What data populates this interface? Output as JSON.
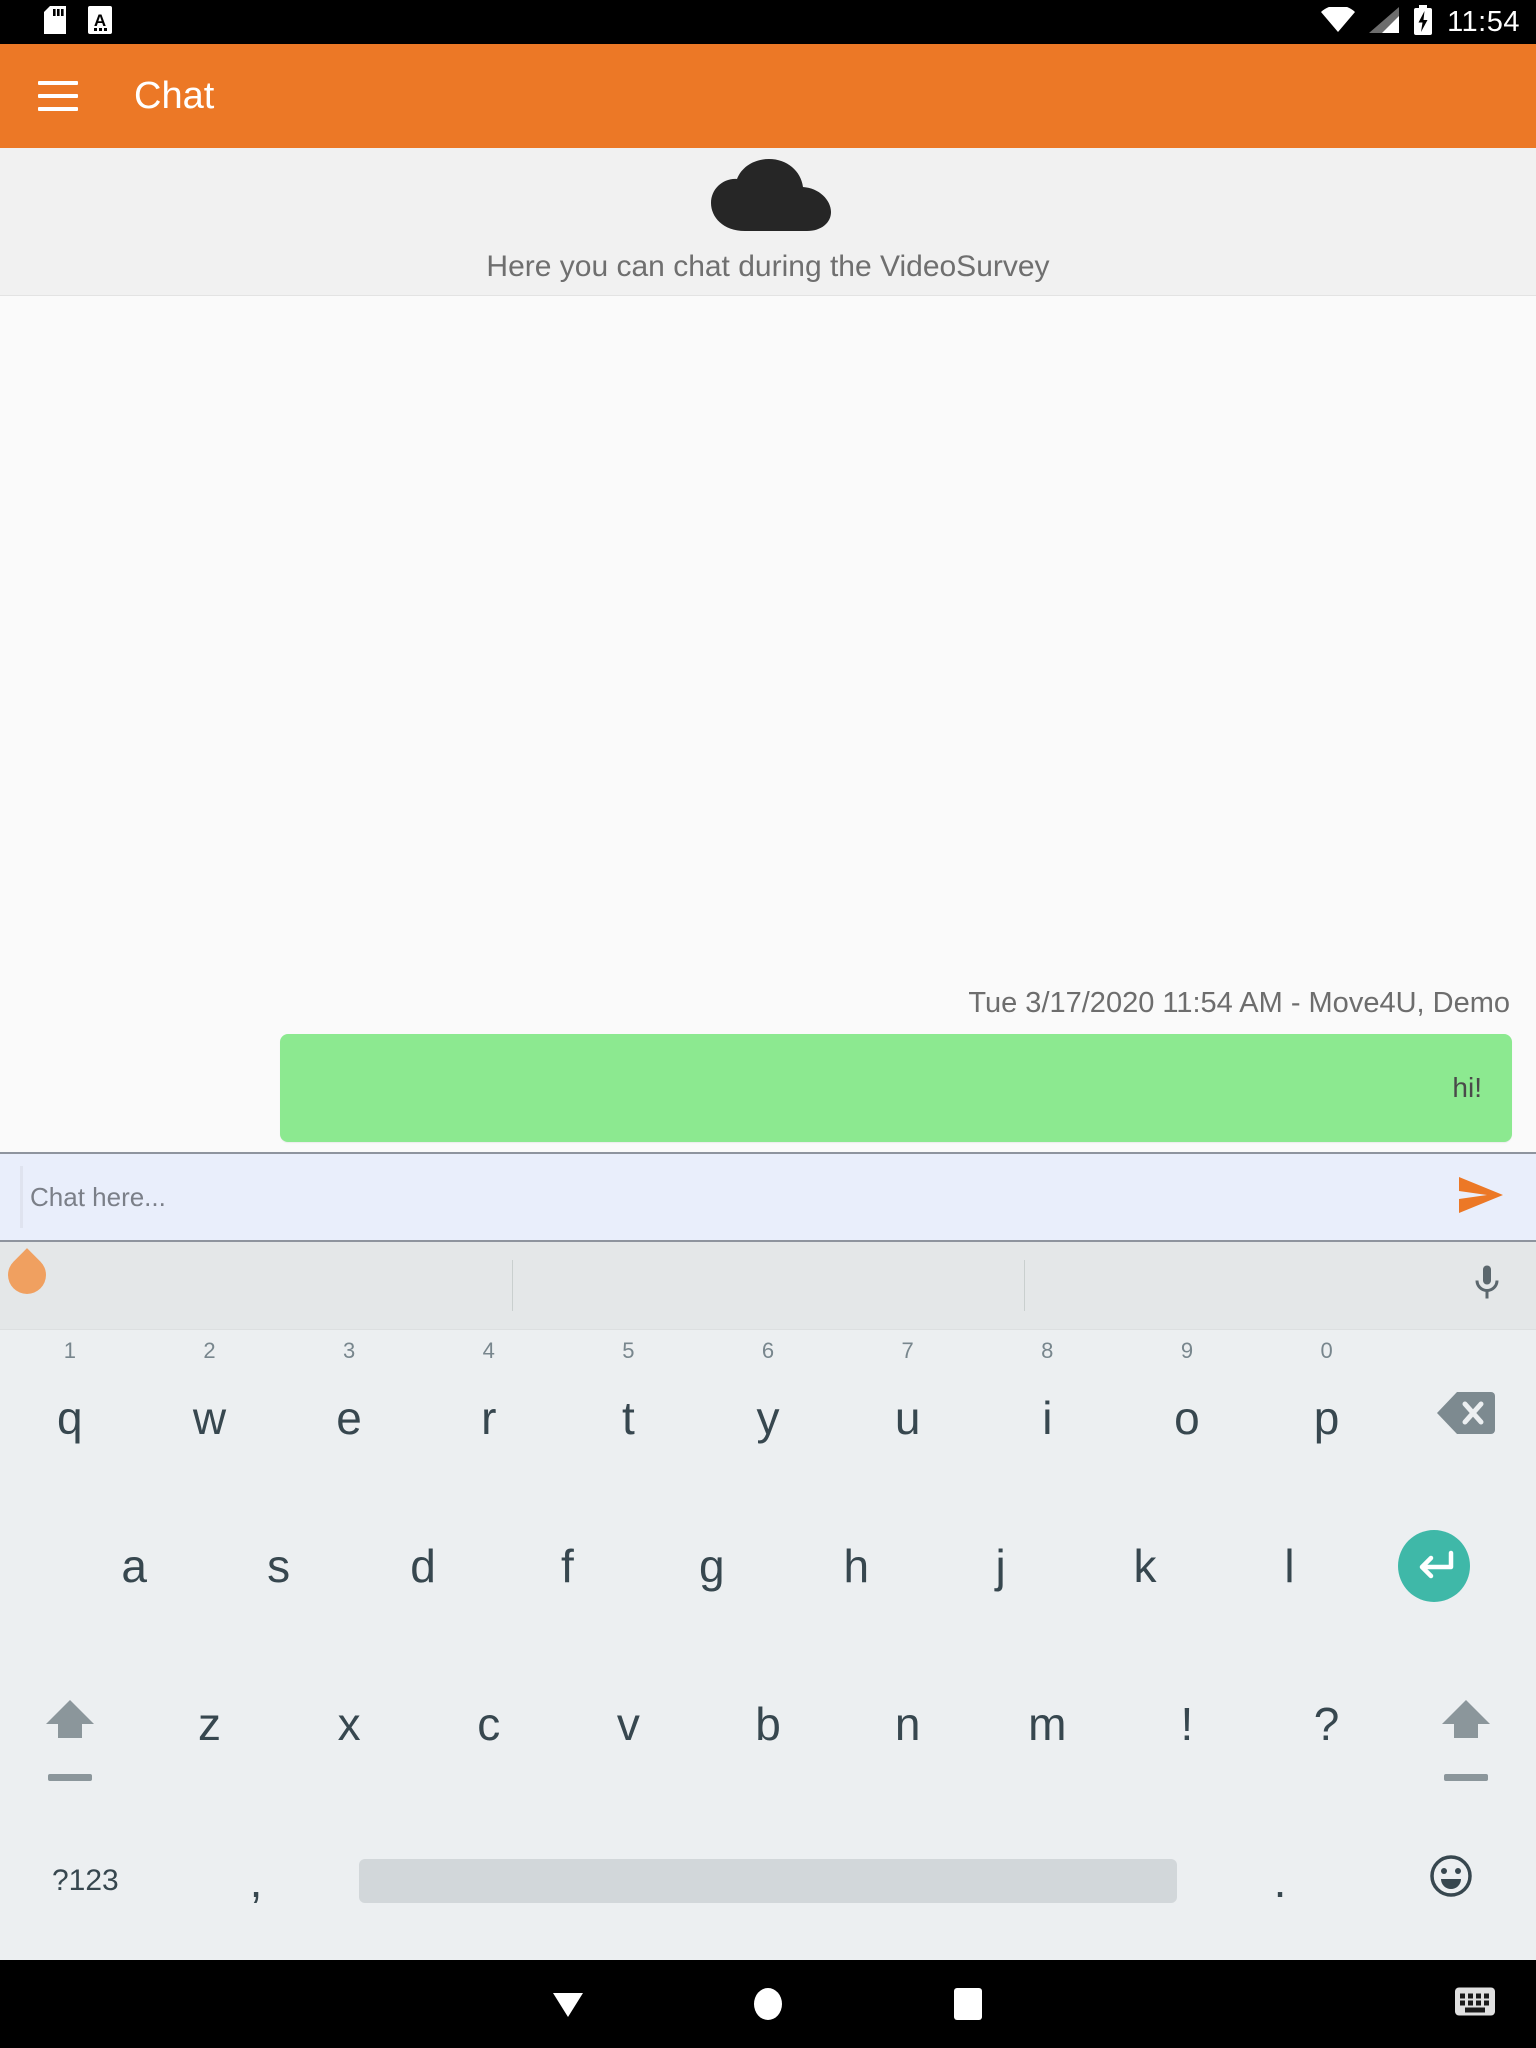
{
  "status_bar": {
    "icons_left": [
      "sd-card-icon",
      "input-method-a-icon"
    ],
    "icons_right": [
      "wifi-icon",
      "cellular-signal-icon",
      "battery-charging-icon"
    ],
    "time": "11:54"
  },
  "app_bar": {
    "menu_icon": "hamburger-menu-icon",
    "title": "Chat",
    "background_color": "#ec7826"
  },
  "banner": {
    "icon": "cloud-icon",
    "text": "Here you can chat during the VideoSurvey",
    "background_color": "#f1f1f1"
  },
  "chat": {
    "messages": [
      {
        "meta": "Tue 3/17/2020 11:54 AM - Move4U, Demo",
        "text": "hi!",
        "align": "right",
        "bubble_color": "#8ce990"
      }
    ]
  },
  "composer": {
    "placeholder": "Chat here...",
    "value": "",
    "send_icon": "send-arrow-icon",
    "send_color": "#ec7826",
    "background_color": "#e9eefb",
    "cursor_handle": "text-cursor-handle"
  },
  "keyboard": {
    "suggestion_bar": {
      "suggestions": [
        "",
        "",
        ""
      ],
      "mic_icon": "microphone-icon"
    },
    "row1": [
      {
        "label": "q",
        "hint": "1"
      },
      {
        "label": "w",
        "hint": "2"
      },
      {
        "label": "e",
        "hint": "3"
      },
      {
        "label": "r",
        "hint": "4"
      },
      {
        "label": "t",
        "hint": "5"
      },
      {
        "label": "y",
        "hint": "6"
      },
      {
        "label": "u",
        "hint": "7"
      },
      {
        "label": "i",
        "hint": "8"
      },
      {
        "label": "o",
        "hint": "9"
      },
      {
        "label": "p",
        "hint": "0"
      }
    ],
    "row1_action": {
      "name": "backspace-key",
      "icon": "backspace-icon"
    },
    "row2": [
      {
        "label": "a"
      },
      {
        "label": "s"
      },
      {
        "label": "d"
      },
      {
        "label": "f"
      },
      {
        "label": "g"
      },
      {
        "label": "h"
      },
      {
        "label": "j"
      },
      {
        "label": "k"
      },
      {
        "label": "l"
      }
    ],
    "row2_action": {
      "name": "enter-key",
      "icon": "enter-arrow-icon",
      "color": "#3fb8a8"
    },
    "row3_left": {
      "name": "shift-key",
      "icon": "shift-up-icon"
    },
    "row3": [
      {
        "label": "z"
      },
      {
        "label": "x"
      },
      {
        "label": "c"
      },
      {
        "label": "v"
      },
      {
        "label": "b"
      },
      {
        "label": "n"
      },
      {
        "label": "m"
      },
      {
        "label": "!"
      },
      {
        "label": "?"
      }
    ],
    "row3_right": {
      "name": "shift-key-right",
      "icon": "shift-up-icon"
    },
    "row4": {
      "symbols_label": "?123",
      "comma_label": ",",
      "space_label": "",
      "period_label": ".",
      "emoji_icon": "emoji-smiley-icon"
    }
  },
  "nav_bar": {
    "back_icon": "hide-keyboard-down-icon",
    "home_icon": "home-circle-icon",
    "recents_icon": "recents-square-icon",
    "switch_keyboard_icon": "keyboard-switch-icon"
  }
}
